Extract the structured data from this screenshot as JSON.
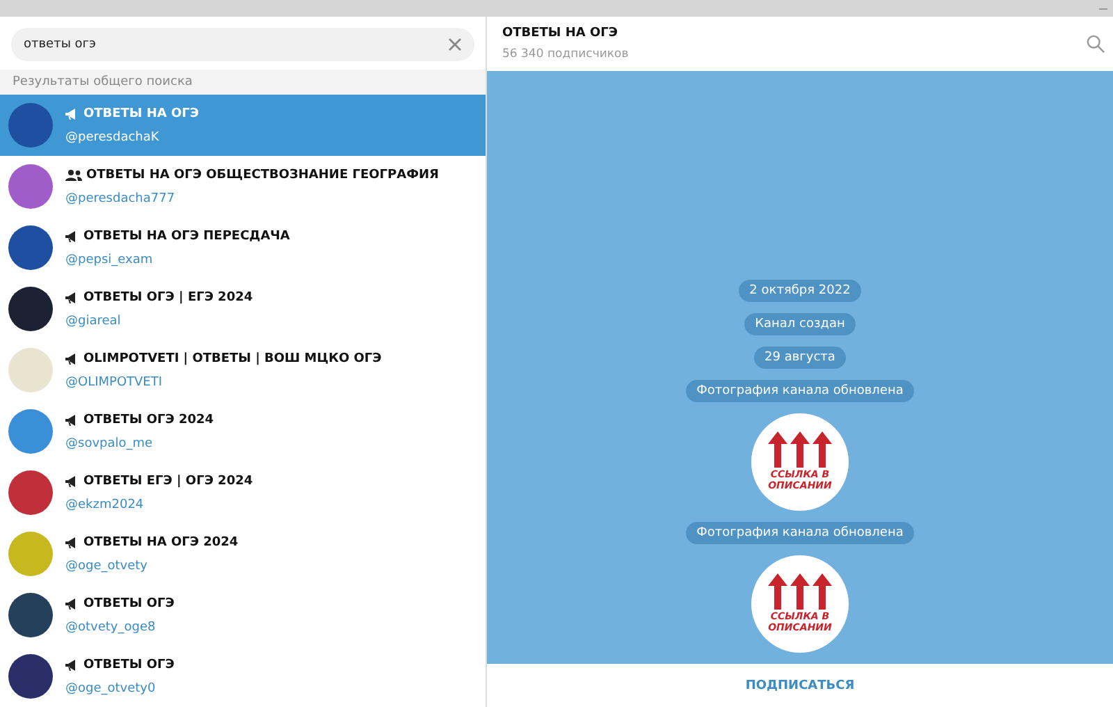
{
  "search": {
    "value": "ответы огэ"
  },
  "section_header": "Результаты общего поиска",
  "results": [
    {
      "kind": "channel",
      "title": "ОТВЕТЫ НА ОГЭ",
      "username": "@peresdachaK",
      "selected": true,
      "color": "#1f4fa0"
    },
    {
      "kind": "group",
      "title": "ОТВЕТЫ НА ОГЭ ОБЩЕСТВОЗНАНИЕ ГЕОГРАФИЯ",
      "username": "@peresdacha777",
      "selected": false,
      "color": "#a05cc8"
    },
    {
      "kind": "channel",
      "title": "ОТВЕТЫ НА ОГЭ ПЕРЕСДАЧА",
      "username": "@pepsi_exam",
      "selected": false,
      "color": "#1f4fa0"
    },
    {
      "kind": "channel",
      "title": "ОТВЕТЫ ОГЭ | ЕГЭ 2024",
      "username": "@giareal",
      "selected": false,
      "color": "#1c2233"
    },
    {
      "kind": "channel",
      "title": "OLIMPOTVETI | ОТВЕТЫ | ВОШ МЦКО ОГЭ",
      "username": "@OLIMPOTVETI",
      "selected": false,
      "color": "#e8e4d0"
    },
    {
      "kind": "channel",
      "title": "ОТВЕТЫ ОГЭ 2024",
      "username": "@sovpalo_me",
      "selected": false,
      "color": "#3a8fd8"
    },
    {
      "kind": "channel",
      "title": "ОТВЕТЫ ЕГЭ | ОГЭ 2024",
      "username": "@ekzm2024",
      "selected": false,
      "color": "#c0303a"
    },
    {
      "kind": "channel",
      "title": "ОТВЕТЫ НА ОГЭ 2024",
      "username": "@oge_otvety",
      "selected": false,
      "color": "#c8b820"
    },
    {
      "kind": "channel",
      "title": "ОТВЕТЫ ОГЭ",
      "username": "@otvety_oge8",
      "selected": false,
      "color": "#24405a"
    },
    {
      "kind": "channel",
      "title": "ОТВЕТЫ ОГЭ",
      "username": "@oge_otvety0",
      "selected": false,
      "color": "#2a2f6a"
    }
  ],
  "chat": {
    "title": "ОТВЕТЫ НА ОГЭ",
    "subtitle": "56 340 подписчиков",
    "messages": [
      {
        "kind": "service",
        "text": "2 октября 2022"
      },
      {
        "kind": "service",
        "text": "Канал создан"
      },
      {
        "kind": "service",
        "text": "29 августа"
      },
      {
        "kind": "service",
        "text": "Фотография канала обновлена"
      },
      {
        "kind": "photo",
        "text": "ССЫЛКА В ОПИСАНИИ"
      },
      {
        "kind": "service",
        "text": "Фотография канала обновлена"
      },
      {
        "kind": "photo",
        "text": "ССЫЛКА В ОПИСАНИИ"
      }
    ],
    "action": "ПОДПИСАТЬСЯ"
  }
}
